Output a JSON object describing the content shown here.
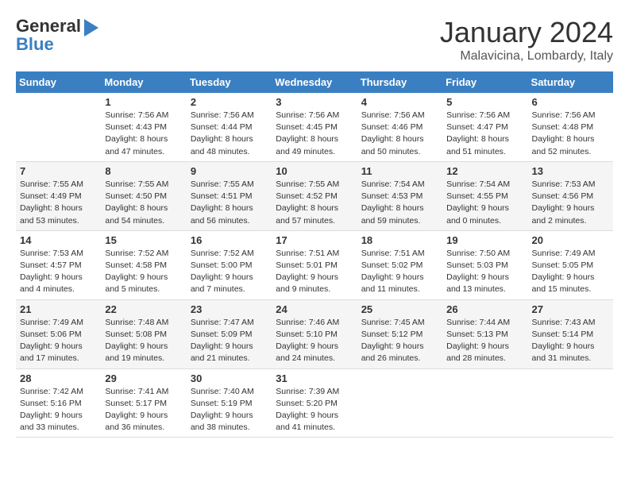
{
  "header": {
    "logo_line1": "General",
    "logo_line2": "Blue",
    "month_title": "January 2024",
    "subtitle": "Malavicina, Lombardy, Italy"
  },
  "days_of_week": [
    "Sunday",
    "Monday",
    "Tuesday",
    "Wednesday",
    "Thursday",
    "Friday",
    "Saturday"
  ],
  "weeks": [
    [
      {
        "day": "",
        "info": ""
      },
      {
        "day": "1",
        "info": "Sunrise: 7:56 AM\nSunset: 4:43 PM\nDaylight: 8 hours\nand 47 minutes."
      },
      {
        "day": "2",
        "info": "Sunrise: 7:56 AM\nSunset: 4:44 PM\nDaylight: 8 hours\nand 48 minutes."
      },
      {
        "day": "3",
        "info": "Sunrise: 7:56 AM\nSunset: 4:45 PM\nDaylight: 8 hours\nand 49 minutes."
      },
      {
        "day": "4",
        "info": "Sunrise: 7:56 AM\nSunset: 4:46 PM\nDaylight: 8 hours\nand 50 minutes."
      },
      {
        "day": "5",
        "info": "Sunrise: 7:56 AM\nSunset: 4:47 PM\nDaylight: 8 hours\nand 51 minutes."
      },
      {
        "day": "6",
        "info": "Sunrise: 7:56 AM\nSunset: 4:48 PM\nDaylight: 8 hours\nand 52 minutes."
      }
    ],
    [
      {
        "day": "7",
        "info": "Sunrise: 7:55 AM\nSunset: 4:49 PM\nDaylight: 8 hours\nand 53 minutes."
      },
      {
        "day": "8",
        "info": "Sunrise: 7:55 AM\nSunset: 4:50 PM\nDaylight: 8 hours\nand 54 minutes."
      },
      {
        "day": "9",
        "info": "Sunrise: 7:55 AM\nSunset: 4:51 PM\nDaylight: 8 hours\nand 56 minutes."
      },
      {
        "day": "10",
        "info": "Sunrise: 7:55 AM\nSunset: 4:52 PM\nDaylight: 8 hours\nand 57 minutes."
      },
      {
        "day": "11",
        "info": "Sunrise: 7:54 AM\nSunset: 4:53 PM\nDaylight: 8 hours\nand 59 minutes."
      },
      {
        "day": "12",
        "info": "Sunrise: 7:54 AM\nSunset: 4:55 PM\nDaylight: 9 hours\nand 0 minutes."
      },
      {
        "day": "13",
        "info": "Sunrise: 7:53 AM\nSunset: 4:56 PM\nDaylight: 9 hours\nand 2 minutes."
      }
    ],
    [
      {
        "day": "14",
        "info": "Sunrise: 7:53 AM\nSunset: 4:57 PM\nDaylight: 9 hours\nand 4 minutes."
      },
      {
        "day": "15",
        "info": "Sunrise: 7:52 AM\nSunset: 4:58 PM\nDaylight: 9 hours\nand 5 minutes."
      },
      {
        "day": "16",
        "info": "Sunrise: 7:52 AM\nSunset: 5:00 PM\nDaylight: 9 hours\nand 7 minutes."
      },
      {
        "day": "17",
        "info": "Sunrise: 7:51 AM\nSunset: 5:01 PM\nDaylight: 9 hours\nand 9 minutes."
      },
      {
        "day": "18",
        "info": "Sunrise: 7:51 AM\nSunset: 5:02 PM\nDaylight: 9 hours\nand 11 minutes."
      },
      {
        "day": "19",
        "info": "Sunrise: 7:50 AM\nSunset: 5:03 PM\nDaylight: 9 hours\nand 13 minutes."
      },
      {
        "day": "20",
        "info": "Sunrise: 7:49 AM\nSunset: 5:05 PM\nDaylight: 9 hours\nand 15 minutes."
      }
    ],
    [
      {
        "day": "21",
        "info": "Sunrise: 7:49 AM\nSunset: 5:06 PM\nDaylight: 9 hours\nand 17 minutes."
      },
      {
        "day": "22",
        "info": "Sunrise: 7:48 AM\nSunset: 5:08 PM\nDaylight: 9 hours\nand 19 minutes."
      },
      {
        "day": "23",
        "info": "Sunrise: 7:47 AM\nSunset: 5:09 PM\nDaylight: 9 hours\nand 21 minutes."
      },
      {
        "day": "24",
        "info": "Sunrise: 7:46 AM\nSunset: 5:10 PM\nDaylight: 9 hours\nand 24 minutes."
      },
      {
        "day": "25",
        "info": "Sunrise: 7:45 AM\nSunset: 5:12 PM\nDaylight: 9 hours\nand 26 minutes."
      },
      {
        "day": "26",
        "info": "Sunrise: 7:44 AM\nSunset: 5:13 PM\nDaylight: 9 hours\nand 28 minutes."
      },
      {
        "day": "27",
        "info": "Sunrise: 7:43 AM\nSunset: 5:14 PM\nDaylight: 9 hours\nand 31 minutes."
      }
    ],
    [
      {
        "day": "28",
        "info": "Sunrise: 7:42 AM\nSunset: 5:16 PM\nDaylight: 9 hours\nand 33 minutes."
      },
      {
        "day": "29",
        "info": "Sunrise: 7:41 AM\nSunset: 5:17 PM\nDaylight: 9 hours\nand 36 minutes."
      },
      {
        "day": "30",
        "info": "Sunrise: 7:40 AM\nSunset: 5:19 PM\nDaylight: 9 hours\nand 38 minutes."
      },
      {
        "day": "31",
        "info": "Sunrise: 7:39 AM\nSunset: 5:20 PM\nDaylight: 9 hours\nand 41 minutes."
      },
      {
        "day": "",
        "info": ""
      },
      {
        "day": "",
        "info": ""
      },
      {
        "day": "",
        "info": ""
      }
    ]
  ]
}
